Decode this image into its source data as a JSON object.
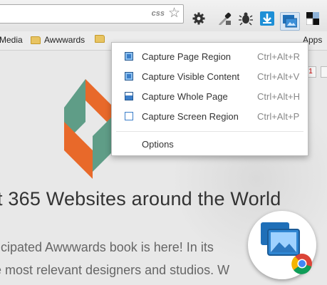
{
  "toolbar": {
    "omnibox_tag": "css",
    "icons": [
      "bookmark-star-icon",
      "gear-icon",
      "eyedropper-icon",
      "bug-icon",
      "download-icon",
      "screenshot-icon",
      "window-icon"
    ]
  },
  "bookmarks": [
    {
      "label": "Media"
    },
    {
      "label": "Awwwards"
    },
    {
      "label": "Apps"
    }
  ],
  "page": {
    "headline": "t 365 Websites around the World",
    "lines": [
      "ticipated Awwwards book is here! In its",
      "e most relevant designers and studios. W"
    ]
  },
  "menu": {
    "items": [
      {
        "label": "Capture Page Region",
        "shortcut": "Ctrl+Alt+R"
      },
      {
        "label": "Capture Visible Content",
        "shortcut": "Ctrl+Alt+V"
      },
      {
        "label": "Capture Whole Page",
        "shortcut": "Ctrl+Alt+H"
      },
      {
        "label": "Capture Screen Region",
        "shortcut": "Ctrl+Alt+P"
      }
    ],
    "options_label": "Options"
  },
  "colors": {
    "accent_blue": "#3b7ec9",
    "logo_orange": "#e8692a",
    "logo_green": "#5f9d87"
  }
}
